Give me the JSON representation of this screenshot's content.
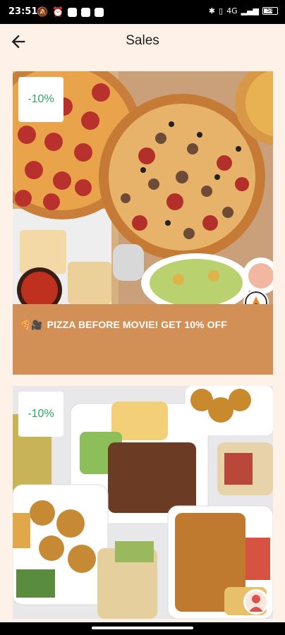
{
  "status_bar": {
    "time": "23:51",
    "signal": "4G",
    "battery": "58"
  },
  "header": {
    "title": "Sales"
  },
  "sales": [
    {
      "discount": "-10%",
      "emoji": "🍕🎥",
      "title": "PIZZA BEFORE MOVIE! GET 10% OFF",
      "image": "pizza-image",
      "logo": "pizza-logo"
    },
    {
      "discount": "-10%",
      "emoji": "",
      "title": "",
      "image": "falafel-doner-image",
      "logo": "restaurant-logo"
    }
  ],
  "colors": {
    "background": "#fdf1e8",
    "card_footer": "#d28f56",
    "discount_text": "#2ea864"
  }
}
